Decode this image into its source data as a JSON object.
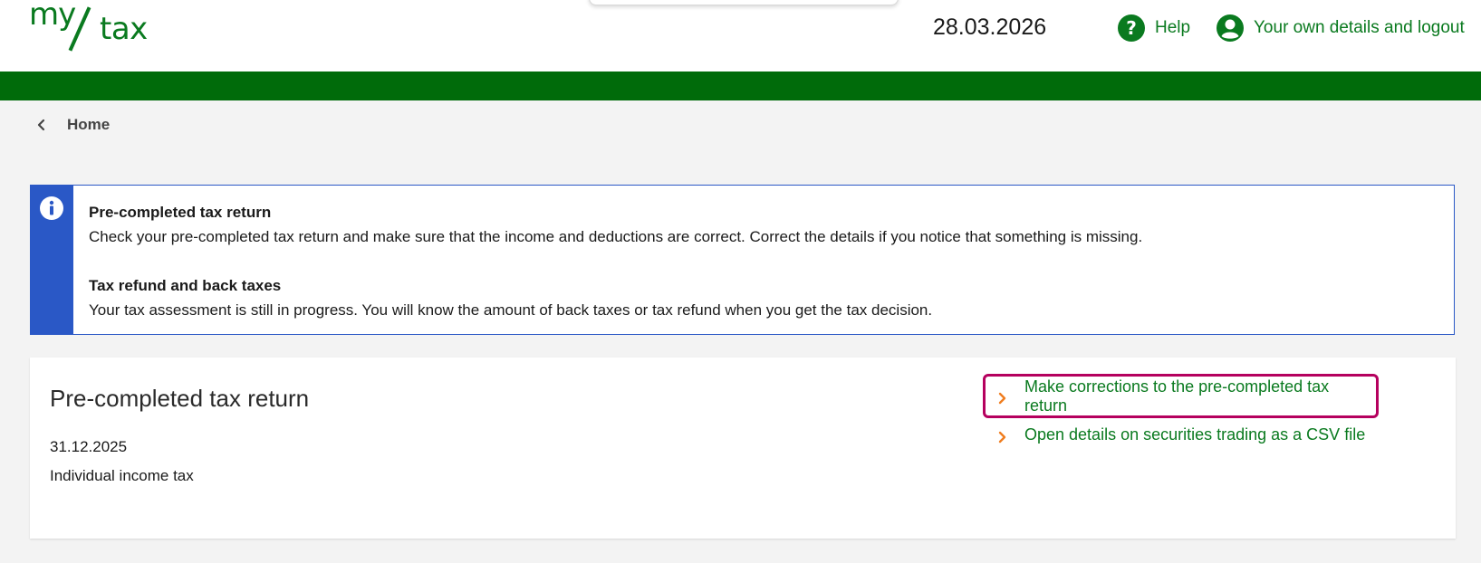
{
  "header": {
    "logo": {
      "part1": "my",
      "part2": "tax"
    },
    "date": "28.03.2026",
    "help_label": "Help",
    "account_label": "Your own details and logout",
    "accent_color": "#0a7a1f",
    "band_color": "#006b0a"
  },
  "breadcrumb": {
    "label": "Home"
  },
  "info": {
    "icon": "info-icon",
    "color": "#2a58c6",
    "items": [
      {
        "title": "Pre-completed tax return",
        "text": "Check your pre-completed tax return and make sure that the income and deductions are correct. Correct the details if you notice that something is missing."
      },
      {
        "title": "Tax refund and back taxes",
        "text": "Your tax assessment is still in progress. You will know the amount of back taxes or tax refund when you get the tax decision."
      }
    ]
  },
  "card": {
    "title": "Pre-completed tax return",
    "date": "31.12.2025",
    "tax_type": "Individual income tax",
    "links": [
      {
        "label": "Make corrections to the pre-completed tax return",
        "highlighted": true
      },
      {
        "label": "Open details on securities trading as a CSV file",
        "highlighted": false
      }
    ],
    "highlight_color": "#b5005e",
    "arrow_color": "#f07d1f"
  }
}
